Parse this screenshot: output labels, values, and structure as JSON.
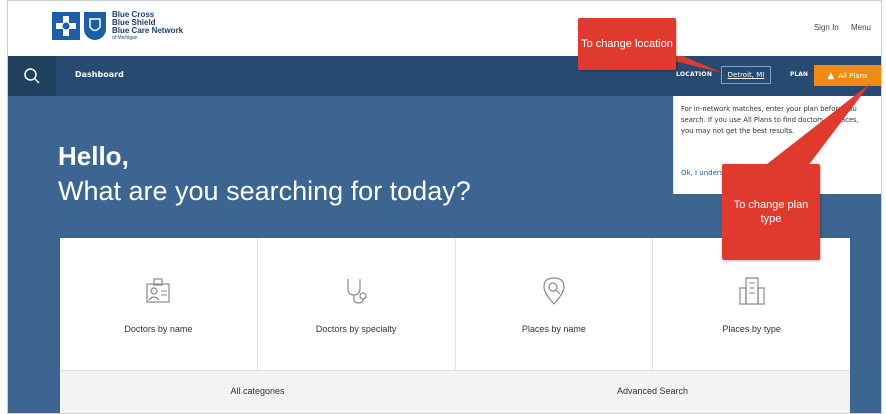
{
  "header": {
    "logo_lines": [
      "Blue Cross",
      "Blue Shield",
      "Blue Care Network",
      "of Michigan"
    ],
    "sign_in": "Sign In",
    "menu": "Menu"
  },
  "nav": {
    "dashboard": "Dashboard",
    "location_label": "LOCATION",
    "location_value": "Detroit, MI",
    "plan_label": "PLAN",
    "plan_button": "All Plans"
  },
  "hero": {
    "hello": "Hello,",
    "question": "What are you searching for today?"
  },
  "cards": [
    {
      "label": "Doctors by name",
      "icon": "id-badge-icon"
    },
    {
      "label": "Doctors by specialty",
      "icon": "stethoscope-icon"
    },
    {
      "label": "Places by name",
      "icon": "map-pin-search-icon"
    },
    {
      "label": "Places by type",
      "icon": "building-icon"
    }
  ],
  "bottom": {
    "all_categories": "All categories",
    "advanced_search": "Advanced Search"
  },
  "popup": {
    "text": "For in-network matches, enter your plan before you search. If you use All Plans to find doctors or places, you may not get the best results.",
    "ok": "Ok, I understand"
  },
  "callouts": {
    "location": "To change location",
    "plan": "To change plan type"
  },
  "colors": {
    "navbar": "#274a73",
    "hero": "#3d6591",
    "plan_button": "#f08a12",
    "callout": "#e03a2f"
  }
}
